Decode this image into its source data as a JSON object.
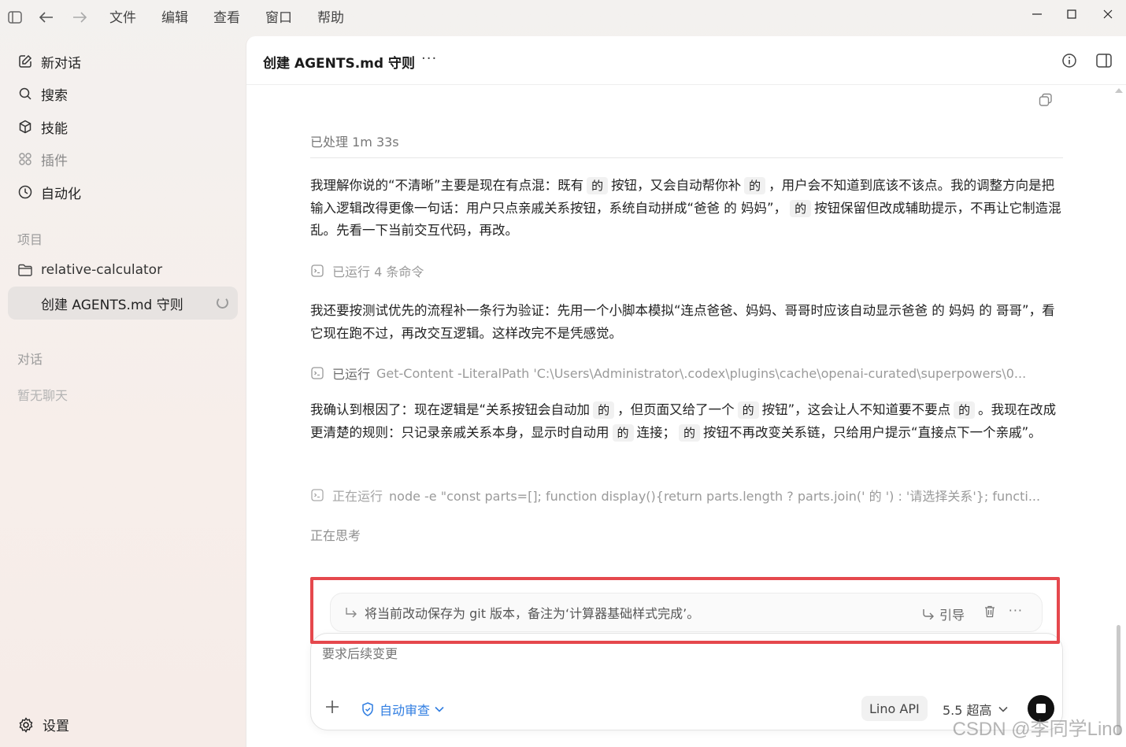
{
  "menu": [
    "文件",
    "编辑",
    "查看",
    "窗口",
    "帮助"
  ],
  "sidebar": {
    "items": [
      {
        "label": "新对话",
        "icon": "edit-icon"
      },
      {
        "label": "搜索",
        "icon": "search-icon"
      },
      {
        "label": "技能",
        "icon": "cube-icon"
      },
      {
        "label": "插件",
        "icon": "grid-icon"
      },
      {
        "label": "自动化",
        "icon": "clock-icon"
      }
    ],
    "projects_label": "项目",
    "project_name": "relative-calculator",
    "active_chat": "创建 AGENTS.md 守则",
    "chats_label": "对话",
    "no_chats": "暂无聊天",
    "settings_label": "设置"
  },
  "header": {
    "title": "创建 AGENTS.md 守则",
    "more": "···"
  },
  "conversation": {
    "processed": "已处理 1m 33s",
    "para1": {
      "s1": "我理解你说的“不清晰”主要是现在有点混：既有",
      "c1": "的",
      "s2": "按钮，又会自动帮你补",
      "c2": "的",
      "s3": "，用户会不知道到底该不该点。我的调整方向是把输入逻辑改得更像一句话：用户只点亲戚关系按钮，系统自动拼成“爸爸 的 妈妈”，",
      "c3": "的",
      "s4": "按钮保留但改成辅助提示，不再让它制造混乱。先看一下当前交互代码，再改。"
    },
    "cmd1": {
      "label": "已运行 4 条命令"
    },
    "para2": "我还要按测试优先的流程补一条行为验证：先用一个小脚本模拟“连点爸爸、妈妈、哥哥时应该自动显示爸爸 的 妈妈 的 哥哥”，看它现在跑不过，再改交互逻辑。这样改完不是凭感觉。",
    "cmd2": {
      "label": "已运行",
      "detail": "Get-Content -LiteralPath 'C:\\Users\\Administrator\\.codex\\plugins\\cache\\openai-curated\\superpowers\\0..."
    },
    "para3": {
      "s1": "我确认到根因了：现在逻辑是“关系按钮会自动加",
      "c1": "的",
      "s2": "，但页面又给了一个",
      "c2": "的",
      "s3": "按钮”，这会让人不知道要不要点",
      "c3": "的",
      "s4": "。我现在改成更清楚的规则：只记录亲戚关系本身，显示时自动用",
      "c4": "的",
      "s5": "连接；",
      "c5": "的",
      "s6": "按钮不再改变关系链，只给用户提示“直接点下一个亲戚”。"
    },
    "cmd3": {
      "label": "正在运行",
      "detail": "node -e \"const parts=[]; function display(){return parts.length ? parts.join(' 的 ') : '请选择关系'}; functi..."
    },
    "thinking": "正在思考"
  },
  "queued": {
    "text": "将当前改动保存为 git 版本，备注为‘计算器基础样式完成’。",
    "quote_label": "引导",
    "more": "···"
  },
  "composer": {
    "placeholder": "要求后续变更",
    "auto_review": "自动审查",
    "api": "Lino API",
    "model": "5.5 超高"
  },
  "watermark": "CSDN @李同学Lino",
  "colors": {
    "accent": "#2f7de1",
    "highlight_border": "#e5484d",
    "stop_button": "#111111"
  }
}
